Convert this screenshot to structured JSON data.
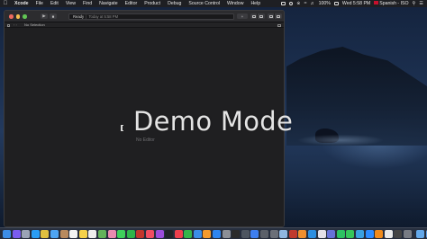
{
  "menubar": {
    "apple_icon": "apple-icon",
    "app_name": "Xcode",
    "items": [
      "File",
      "Edit",
      "View",
      "Find",
      "Navigate",
      "Editor",
      "Product",
      "Debug",
      "Source Control",
      "Window",
      "Help"
    ],
    "battery": "100%",
    "clock": "Wed 5:58 PM",
    "input_source": "Spanish - ISO"
  },
  "window": {
    "activity": {
      "status": "Ready",
      "separator": "|",
      "time": "Today at 5:58 PM"
    },
    "tabbar": {
      "no_selection": "No Selection"
    },
    "editor": {
      "placeholder": "No Editor"
    }
  },
  "overlay": {
    "demo_mode": "Demo Mode"
  },
  "dock": {
    "apps": [
      {
        "name": "finder-icon",
        "color": "#3d8ee8"
      },
      {
        "name": "siri-icon",
        "color": "#7a5cf0"
      },
      {
        "name": "launchpad-icon",
        "color": "#9aa3b5"
      },
      {
        "name": "safari-icon",
        "color": "#2a9df4"
      },
      {
        "name": "chrome-icon",
        "color": "#e0c040"
      },
      {
        "name": "mail-icon",
        "color": "#4ea4f2"
      },
      {
        "name": "contacts-icon",
        "color": "#b88a5e"
      },
      {
        "name": "calendar-icon",
        "color": "#f3f3f3"
      },
      {
        "name": "notes-icon",
        "color": "#f6d24a"
      },
      {
        "name": "reminders-icon",
        "color": "#eeeeee"
      },
      {
        "name": "maps-icon",
        "color": "#63b35a"
      },
      {
        "name": "photos-icon",
        "color": "#e98bb0"
      },
      {
        "name": "messages-icon",
        "color": "#3ecf5b"
      },
      {
        "name": "facetime-icon",
        "color": "#2fb44a"
      },
      {
        "name": "photo-booth-icon",
        "color": "#c2352d"
      },
      {
        "name": "music-icon",
        "color": "#f04d63"
      },
      {
        "name": "podcasts-icon",
        "color": "#9b4ddb"
      },
      {
        "name": "tv-icon",
        "color": "#222428"
      },
      {
        "name": "news-icon",
        "color": "#ee3f4d"
      },
      {
        "name": "numbers-icon",
        "color": "#34b44a"
      },
      {
        "name": "keynote-icon",
        "color": "#3b8de6"
      },
      {
        "name": "pages-icon",
        "color": "#f49a2c"
      },
      {
        "name": "app-store-icon",
        "color": "#2f86f0"
      },
      {
        "name": "system-preferences-icon",
        "color": "#8c8f96"
      },
      {
        "name": "terminal-icon",
        "color": "#2b2b2b"
      },
      {
        "name": "activity-monitor-icon",
        "color": "#4d5560"
      },
      {
        "name": "xcode-icon",
        "color": "#3d7ef0"
      },
      {
        "name": "simulator-icon",
        "color": "#5a5f68"
      },
      {
        "name": "instruments-icon",
        "color": "#6b6f78"
      },
      {
        "name": "preview-icon",
        "color": "#8fb6e0"
      },
      {
        "name": "filezilla-icon",
        "color": "#c03a2e"
      },
      {
        "name": "sublime-icon",
        "color": "#ef8f2f"
      },
      {
        "name": "vscode-icon",
        "color": "#2c8ee0"
      },
      {
        "name": "slack-icon",
        "color": "#e4e0e8"
      },
      {
        "name": "discord-icon",
        "color": "#6672d8"
      },
      {
        "name": "spotify-icon",
        "color": "#2cc262"
      },
      {
        "name": "whatsapp-icon",
        "color": "#35c65a"
      },
      {
        "name": "telegram-icon",
        "color": "#3aa0e0"
      },
      {
        "name": "zoom-icon",
        "color": "#2d8cff"
      },
      {
        "name": "vlc-icon",
        "color": "#f08a1a"
      },
      {
        "name": "textedit-icon",
        "color": "#e9e9e9"
      },
      {
        "name": "calculator-icon",
        "color": "#444444"
      },
      {
        "name": "screenshot-icon",
        "color": "#777b83"
      },
      {
        "name": "folder-icon",
        "color": "#63a8ea"
      },
      {
        "name": "downloads-icon",
        "color": "#5ea0e6"
      },
      {
        "name": "trash-icon",
        "color": "#b9bec7"
      }
    ]
  }
}
